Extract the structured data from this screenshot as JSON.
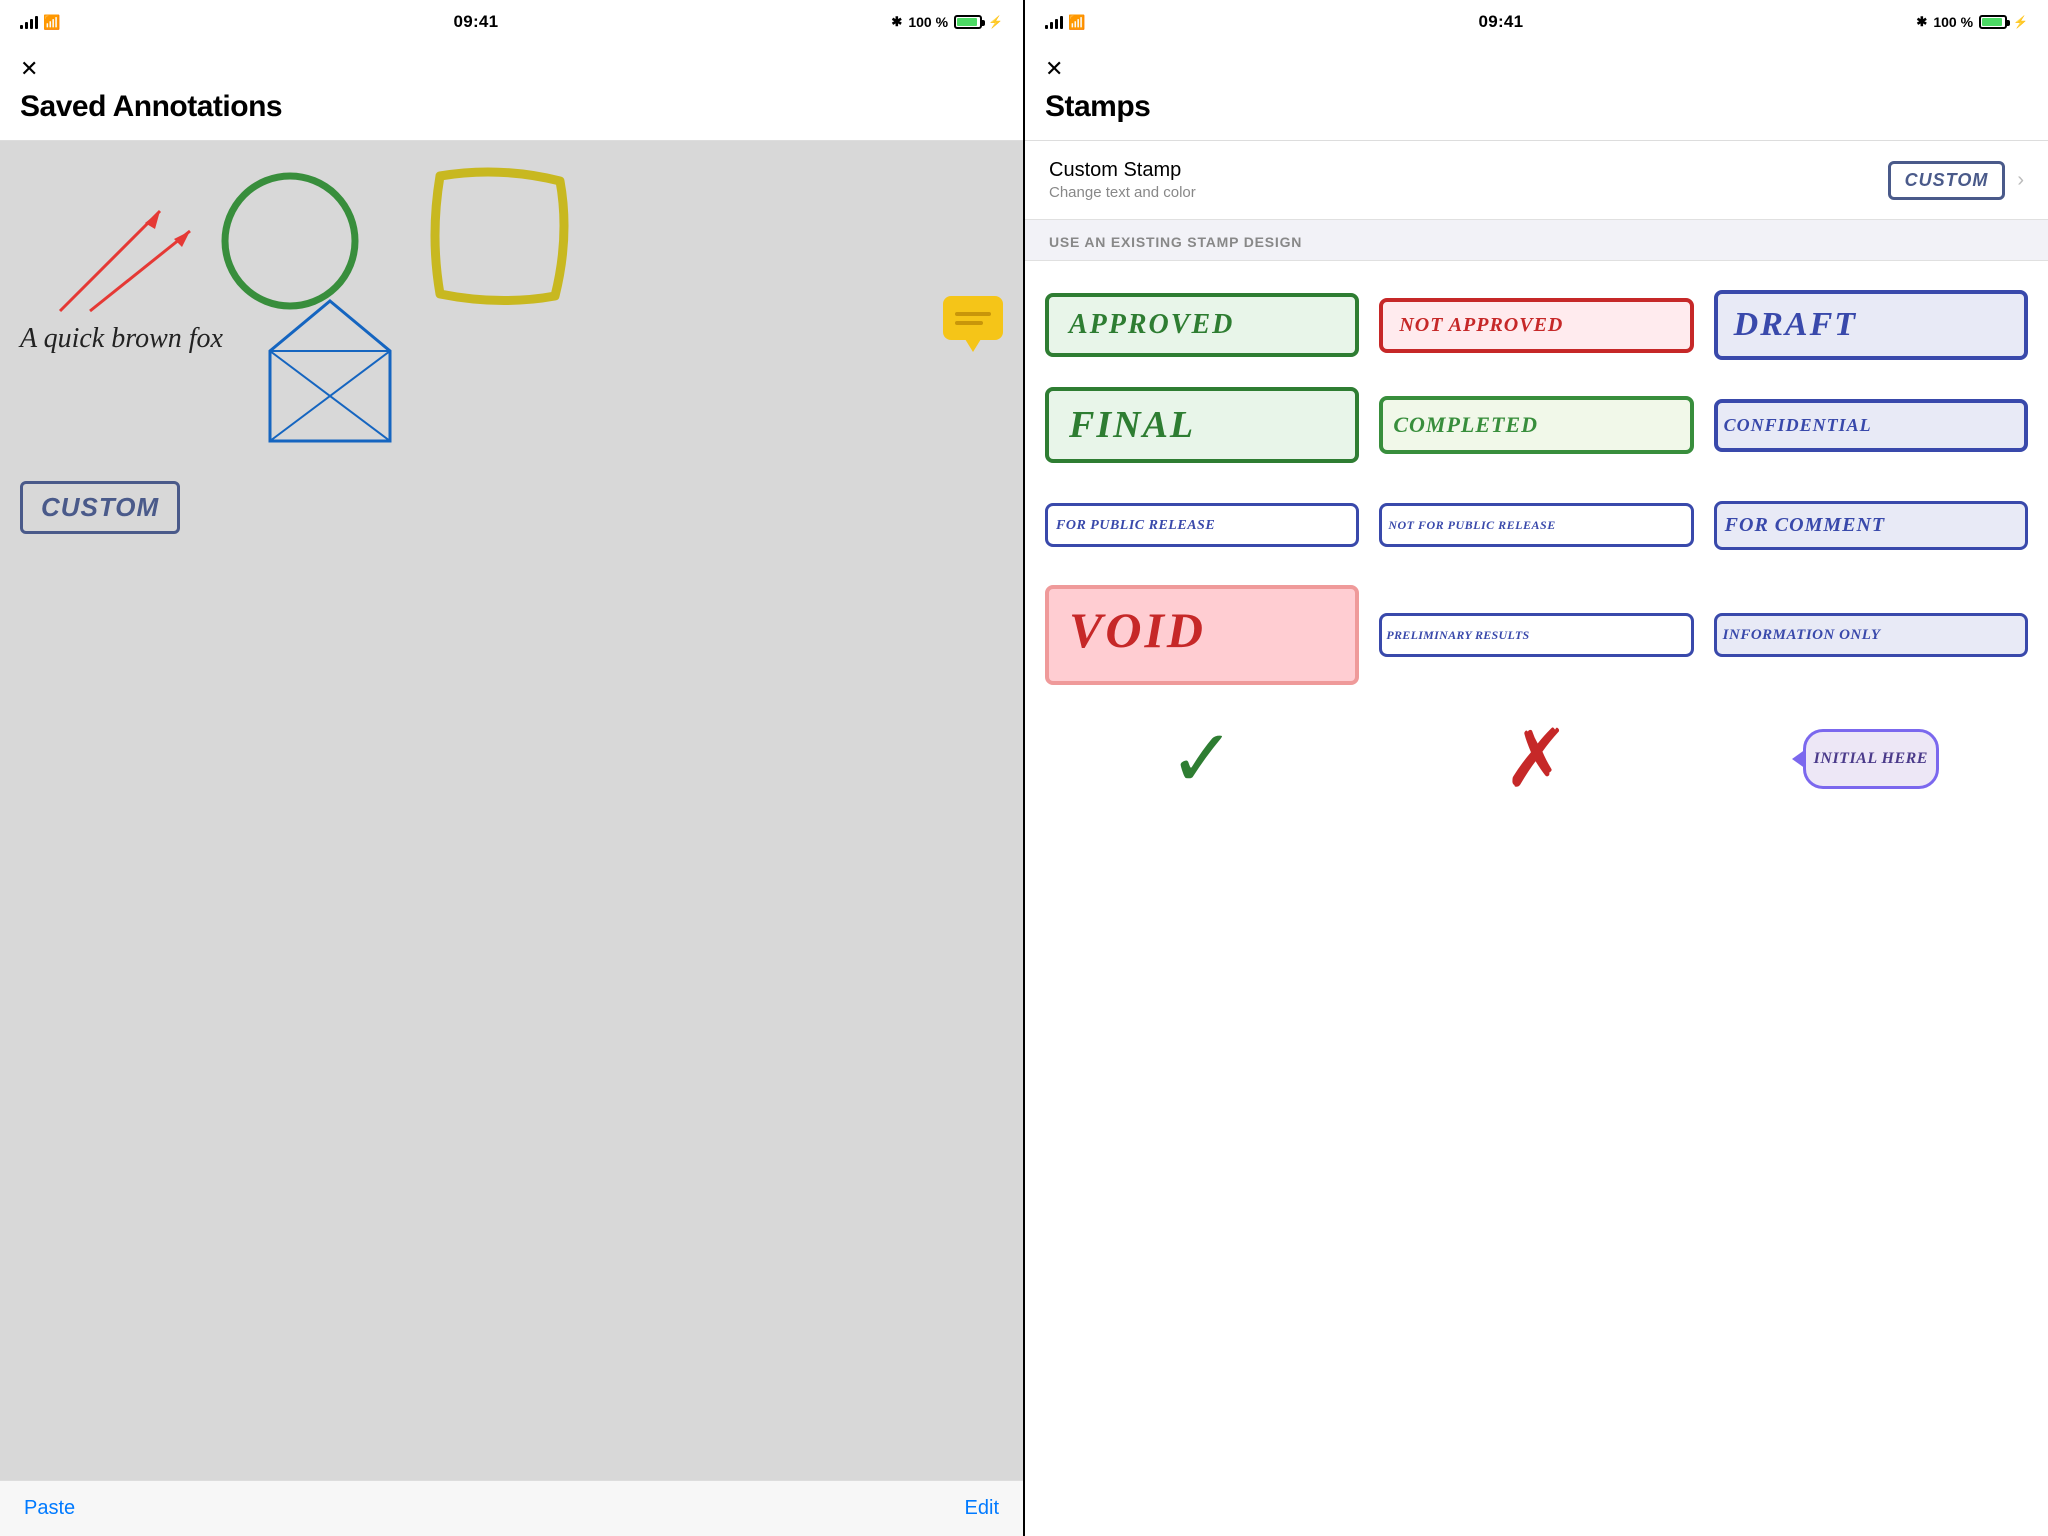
{
  "left_panel": {
    "status": {
      "time": "09:41",
      "signal": "●●●●",
      "wifi": "wifi",
      "bluetooth": "BT",
      "battery_percent": "100 %"
    },
    "close_label": "✕",
    "title": "Saved Annotations",
    "annotations": {
      "text_label": "A quick\nbrown fox"
    },
    "footer": {
      "paste_label": "Paste",
      "edit_label": "Edit"
    }
  },
  "right_panel": {
    "status": {
      "time": "09:41",
      "battery_percent": "100 %"
    },
    "close_label": "✕",
    "title": "Stamps",
    "custom_stamp": {
      "title": "Custom Stamp",
      "subtitle": "Change text and color",
      "preview_label": "CUSTOM"
    },
    "section_label": "USE AN EXISTING STAMP DESIGN",
    "stamps": [
      {
        "id": "approved",
        "label": "APPROVED"
      },
      {
        "id": "not-approved",
        "label": "NOT APPROVED"
      },
      {
        "id": "draft",
        "label": "DRAFT"
      },
      {
        "id": "final",
        "label": "FINAL"
      },
      {
        "id": "completed",
        "label": "COMPLETED"
      },
      {
        "id": "confidential",
        "label": "CONFIDENTIAL"
      },
      {
        "id": "for-public-release",
        "label": "FOR PUBLIC RELEASE"
      },
      {
        "id": "not-for-public-release",
        "label": "NOT FOR PUBLIC RELEASE"
      },
      {
        "id": "for-comment",
        "label": "FOR COMMENT"
      },
      {
        "id": "void",
        "label": "VOID"
      },
      {
        "id": "preliminary-results",
        "label": "PRELIMINARY RESULTS"
      },
      {
        "id": "information-only",
        "label": "INFORMATION ONLY"
      },
      {
        "id": "checkmark",
        "label": "✓"
      },
      {
        "id": "xmark",
        "label": "✗"
      },
      {
        "id": "initial-here",
        "label": "INITIAL HERE"
      }
    ]
  }
}
